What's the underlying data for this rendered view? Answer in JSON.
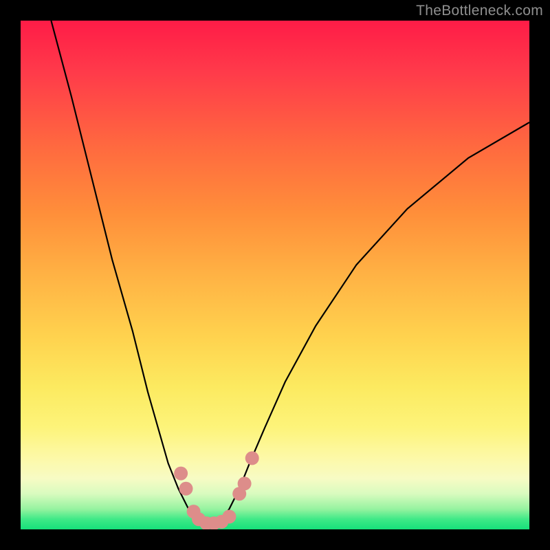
{
  "watermark": "TheBottleneck.com",
  "colors": {
    "background": "#000000",
    "curve": "#000000",
    "marker": "#dd8d8a",
    "watermark": "#8f8f8f"
  },
  "chart_data": {
    "type": "line",
    "title": "",
    "xlabel": "",
    "ylabel": "",
    "xlim": [
      0,
      100
    ],
    "ylim": [
      0,
      100
    ],
    "grid": false,
    "series": [
      {
        "name": "bottleneck-curve",
        "x": [
          6,
          10,
          14,
          18,
          22,
          25,
          27,
          29,
          31,
          33,
          34.5,
          36,
          37.5,
          39,
          41,
          43,
          45,
          48,
          52,
          58,
          66,
          76,
          88,
          100
        ],
        "y": [
          100,
          85,
          69,
          53,
          39,
          27,
          20,
          13,
          8,
          4,
          1.5,
          1,
          1,
          1.5,
          4,
          8,
          13,
          20,
          29,
          40,
          52,
          63,
          73,
          80
        ],
        "comment": "Values are bottleneck percentage (vertical position from bottom=0 to top=100) read off the gradient; horizontal axis is relative hardware balance 0–100. This curve is a stylized V-shape with its minimum (≈1%) around x≈36–39."
      }
    ],
    "markers": {
      "comment": "Salmon bead markers clustered near the valley of the curve",
      "points": [
        {
          "x": 31.5,
          "y": 11
        },
        {
          "x": 32.5,
          "y": 8
        },
        {
          "x": 34,
          "y": 3.5
        },
        {
          "x": 35,
          "y": 2
        },
        {
          "x": 36.5,
          "y": 1.2
        },
        {
          "x": 38,
          "y": 1.2
        },
        {
          "x": 39.5,
          "y": 1.5
        },
        {
          "x": 41,
          "y": 2.5
        },
        {
          "x": 43,
          "y": 7
        },
        {
          "x": 44,
          "y": 9
        },
        {
          "x": 45.5,
          "y": 14
        }
      ]
    }
  }
}
